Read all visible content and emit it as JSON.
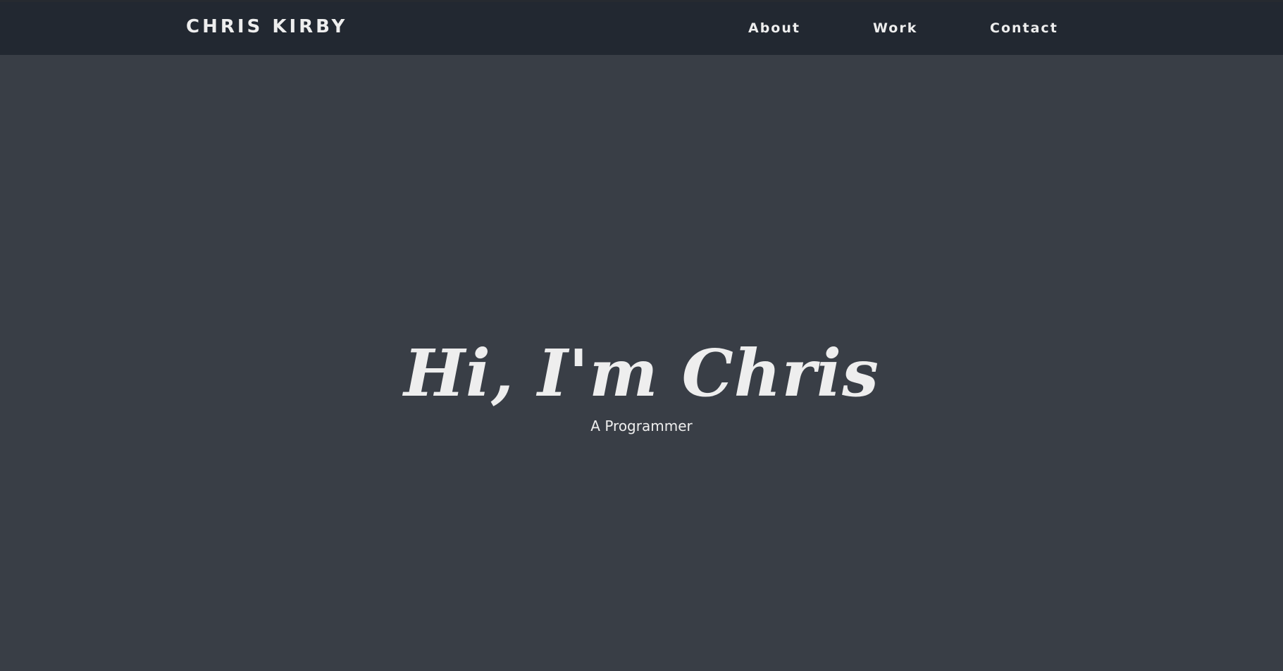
{
  "nav": {
    "logo": "CHRIS KIRBY",
    "links": [
      {
        "label": "About"
      },
      {
        "label": "Work"
      },
      {
        "label": "Contact"
      }
    ]
  },
  "hero": {
    "title": "Hi, I'm Chris",
    "subtitle": "A Programmer"
  },
  "colors": {
    "navbar": "#222831",
    "background": "#393e46",
    "text": "#eeeeee"
  }
}
